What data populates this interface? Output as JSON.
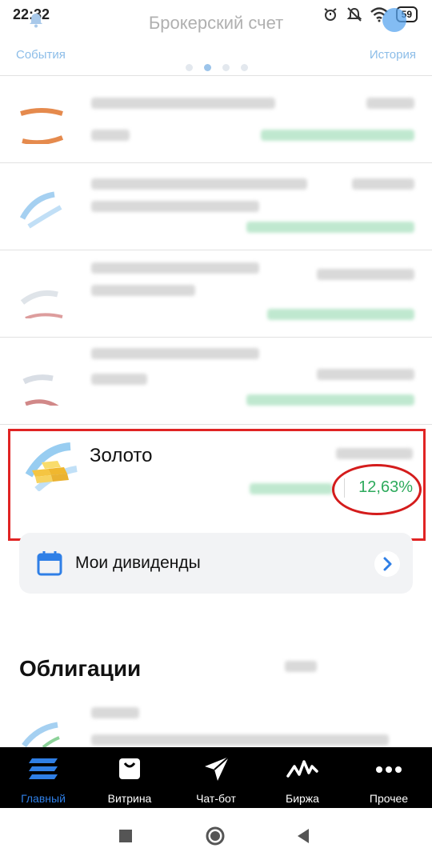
{
  "status_bar": {
    "time": "22:32",
    "battery": "59"
  },
  "header": {
    "title": "Брокерский счет",
    "left_link": "События",
    "right_link": "История",
    "pager_count": 4,
    "pager_active": 1
  },
  "assets": {
    "gold": {
      "name": "Золото",
      "change_pct": "12,63%"
    }
  },
  "dividends": {
    "label": "Мои дивиденды"
  },
  "bonds": {
    "title": "Облигации"
  },
  "bottom_nav": {
    "items": [
      {
        "label": "Главный",
        "icon": "stack-icon",
        "active": true
      },
      {
        "label": "Витрина",
        "icon": "shopping-bag-icon",
        "active": false
      },
      {
        "label": "Чат-бот",
        "icon": "send-icon",
        "active": false
      },
      {
        "label": "Биржа",
        "icon": "activity-icon",
        "active": false
      },
      {
        "label": "Прочее",
        "icon": "more-dots-icon",
        "active": false
      }
    ]
  },
  "colors": {
    "accent_blue": "#2f7fe6",
    "positive_green": "#2daa5c",
    "annotation_red": "#e02424",
    "nav_background": "#000000"
  }
}
